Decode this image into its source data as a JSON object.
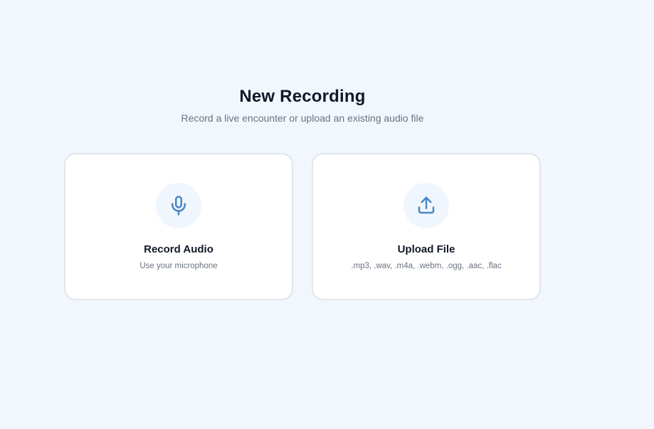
{
  "header": {
    "title": "New Recording",
    "subtitle": "Record a live encounter or upload an existing audio file"
  },
  "cards": [
    {
      "icon": "microphone-icon",
      "title": "Record Audio",
      "subtitle": "Use your microphone"
    },
    {
      "icon": "upload-icon",
      "title": "Upload File",
      "subtitle": ".mp3, .wav, .m4a, .webm, .ogg, .aac, .flac"
    }
  ],
  "colors": {
    "background": "#f1f7fd",
    "card_background": "#ffffff",
    "card_border": "#e1e6ed",
    "icon_circle": "#eff6fd",
    "icon_stroke": "#4a86c5",
    "title_text": "#111827",
    "muted_text": "#6b7280"
  }
}
